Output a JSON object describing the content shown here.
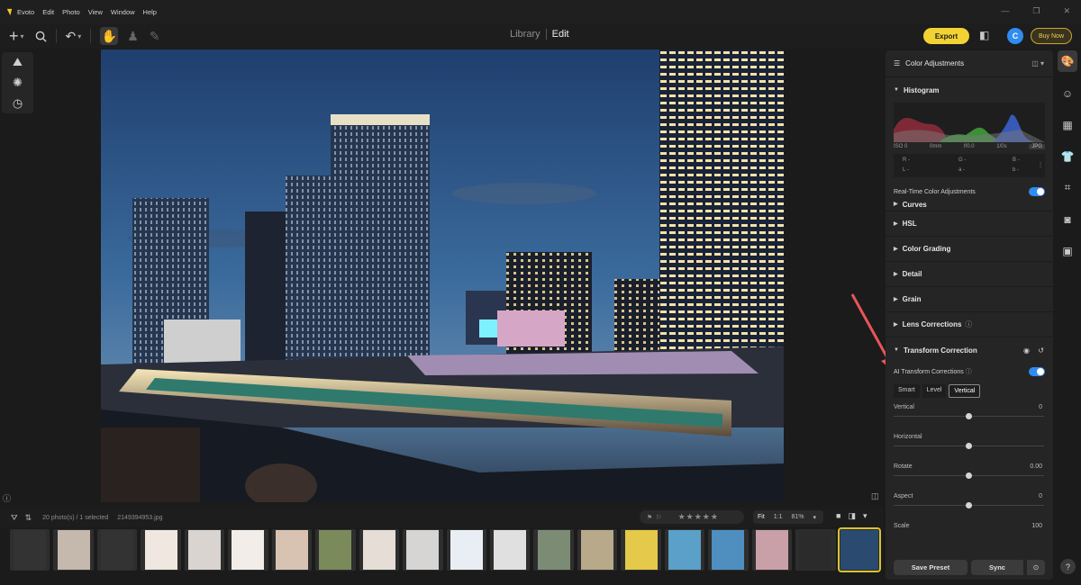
{
  "app": {
    "name": "Evoto"
  },
  "menu": [
    "Evoto",
    "Edit",
    "Photo",
    "View",
    "Window",
    "Help"
  ],
  "modes": {
    "library": "Library",
    "edit": "Edit"
  },
  "toolbar": {
    "export": "Export",
    "avatar_letter": "C",
    "buy_now": "Buy Now"
  },
  "filmstrip": {
    "count_text": "20 photo(s) / 1 selected",
    "file_name": "2149394953.jpg",
    "zoom_fit": "Fit",
    "zoom_11": "1:1",
    "zoom_value": "81%",
    "stars": "★★★★★"
  },
  "panel": {
    "header": "Color Adjustments",
    "histogram_title": "Histogram",
    "exif": {
      "iso": "ISO 0",
      "focal": "0mm",
      "aperture": "f/0.0",
      "shutter": "1/0s",
      "format": "JPG"
    },
    "rgb": {
      "r": "R -",
      "g": "G -",
      "b": "B -",
      "l": "L -",
      "a": "a -",
      "b2": "b -"
    },
    "realtime_label": "Real-Time Color Adjustments",
    "sections": [
      "Curves",
      "HSL",
      "Color Grading",
      "Detail",
      "Grain",
      "Lens Corrections"
    ],
    "transform_title": "Transform Correction",
    "ai_transform_label": "AI Transform Corrections",
    "modes": [
      "Smart",
      "Level",
      "Vertical"
    ],
    "sliders": [
      {
        "label": "Vertical",
        "value": "0"
      },
      {
        "label": "Horizontal",
        "value": ""
      },
      {
        "label": "Rotate",
        "value": "0.00"
      },
      {
        "label": "Aspect",
        "value": "0"
      },
      {
        "label": "Scale",
        "value": "100"
      }
    ],
    "save_preset": "Save Preset",
    "sync": "Sync"
  },
  "colors": {
    "accent": "#2f8cf0",
    "export": "#f3d333",
    "selection": "#d9c230"
  }
}
